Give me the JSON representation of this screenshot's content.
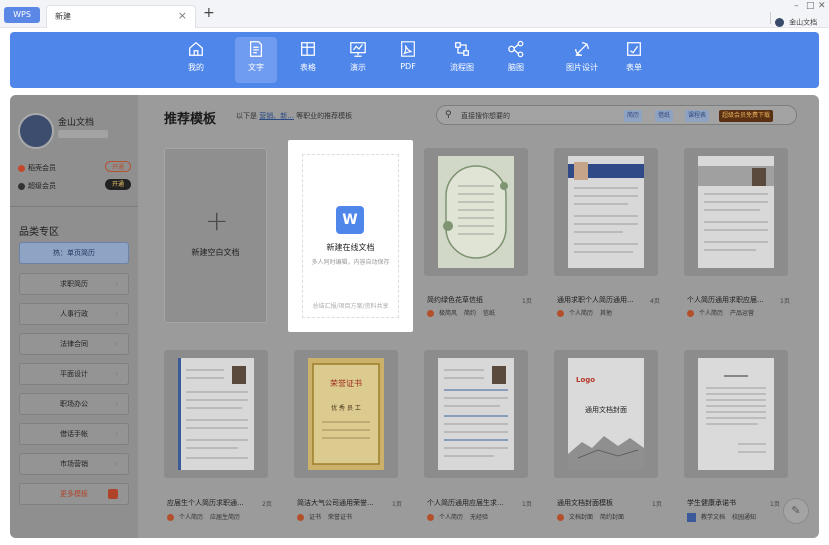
{
  "tabbar": {
    "app_label": "WPS",
    "doc_tab": "新建",
    "close": "×",
    "plus": "+",
    "minimize": "–",
    "restore": "□",
    "close_window": "✕",
    "account_name": "金山文档"
  },
  "toolbar": [
    {
      "label": "我的",
      "icon": "home-icon"
    },
    {
      "label": "文字",
      "icon": "document-icon",
      "selected": true
    },
    {
      "label": "表格",
      "icon": "table-icon"
    },
    {
      "label": "演示",
      "icon": "presentation-icon"
    },
    {
      "label": "PDF",
      "icon": "pdf-icon"
    },
    {
      "label": "流程图",
      "icon": "flowchart-icon"
    },
    {
      "label": "脑图",
      "icon": "mindmap-icon"
    },
    {
      "label": "图片设计",
      "icon": "image-design-icon"
    },
    {
      "label": "表单",
      "icon": "form-icon"
    }
  ],
  "sidebar": {
    "user_name": "金山文档",
    "members": [
      {
        "label": "稻壳会员",
        "button": "开通"
      },
      {
        "label": "超级会员",
        "button": "开通"
      }
    ],
    "heading": "品类专区",
    "categories": [
      "热：单页简历",
      "求职简历",
      "人事行政",
      "法律合同",
      "平面设计",
      "职场办公",
      "借话手帐",
      "市场营销",
      "更多模板"
    ]
  },
  "main": {
    "title": "推荐模板",
    "subtitle_prefix": "以下是",
    "subtitle_link": "营销、新...",
    "subtitle_suffix": "等职业的推荐模板",
    "search_placeholder": "直接搜你想要的",
    "search_tags": [
      "简历",
      "借纸",
      "课程表",
      "超级会员免费下载"
    ]
  },
  "blank_card": {
    "label": "新建空白文档"
  },
  "online_card": {
    "logo": "W",
    "title": "新建在线文档",
    "desc": "多人同时编辑，内容自动保存",
    "footer": "总结汇报/项目方案/资料共享"
  },
  "templates": [
    {
      "title": "简约绿色花草信纸",
      "pages": "1页",
      "tags": [
        "极简风",
        "简约",
        "信纸"
      ],
      "tag_style": "dot"
    },
    {
      "title": "通用求职个人简历通用...",
      "pages": "4页",
      "tags": [
        "个人简历",
        "其他"
      ],
      "tag_style": "dot"
    },
    {
      "title": "个人简历通用求职应届...",
      "pages": "1页",
      "tags": [
        "个人简历",
        "产品运营"
      ],
      "tag_style": "dot"
    },
    {
      "title": "应届生个人简历求职通...",
      "pages": "2页",
      "tags": [
        "个人简历",
        "应届生简历"
      ],
      "tag_style": "dot"
    },
    {
      "title": "简洁大气公司通用荣誉...",
      "pages": "1页",
      "tags": [
        "证书",
        "荣誉证书"
      ],
      "tag_style": "dot"
    },
    {
      "title": "个人简历通用应届生求...",
      "pages": "1页",
      "tags": [
        "个人简历",
        "无经验"
      ],
      "tag_style": "dot"
    },
    {
      "title": "通用文档封面模板",
      "pages": "1页",
      "tags": [
        "文档封面",
        "简约封面"
      ],
      "tag_style": "dot"
    },
    {
      "title": "学生健康承诺书",
      "pages": "1页",
      "tags": [
        "教学文档",
        "校园通知"
      ],
      "tag_style": "square"
    }
  ],
  "previews": {
    "certificate_title": "荣誉证书",
    "certificate_name": "优 秀 员 工",
    "cover_logo": "Logo",
    "cover_title": "通用文档封面"
  },
  "chat_icon": "chat-icon"
}
